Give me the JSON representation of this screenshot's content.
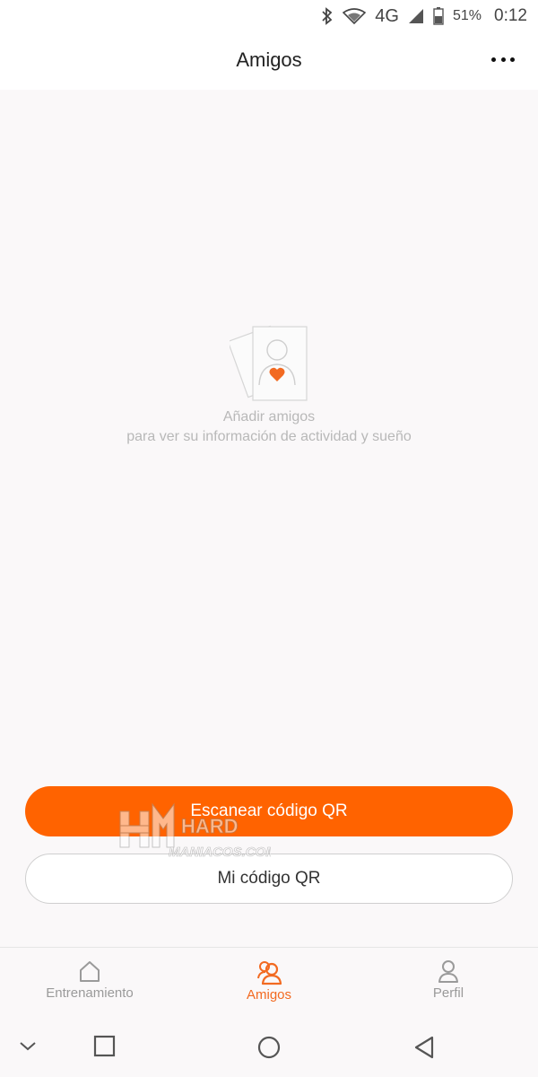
{
  "status_bar": {
    "network": "4G",
    "battery": "51%",
    "time": "0:12"
  },
  "header": {
    "title": "Amigos",
    "more_icon": "more-horizontal-icon"
  },
  "empty_state": {
    "illustration": "add-friends-illustration",
    "title": "Añadir amigos",
    "subtitle": "para ver su información de actividad y sueño"
  },
  "actions": {
    "scan_label": "Escanear código QR",
    "myqr_label": "Mi código QR"
  },
  "watermark": {
    "line1": "HARD",
    "line2": "MANIACOS.COM"
  },
  "bottom_nav": {
    "items": [
      {
        "label": "Entrenamiento",
        "icon": "home-icon",
        "active": false
      },
      {
        "label": "Amigos",
        "icon": "friends-icon",
        "active": true
      },
      {
        "label": "Perfil",
        "icon": "profile-icon",
        "active": false
      }
    ]
  },
  "colors": {
    "accent": "#ff6300",
    "background": "#faf8f9",
    "muted_text": "#b8b8b8"
  }
}
